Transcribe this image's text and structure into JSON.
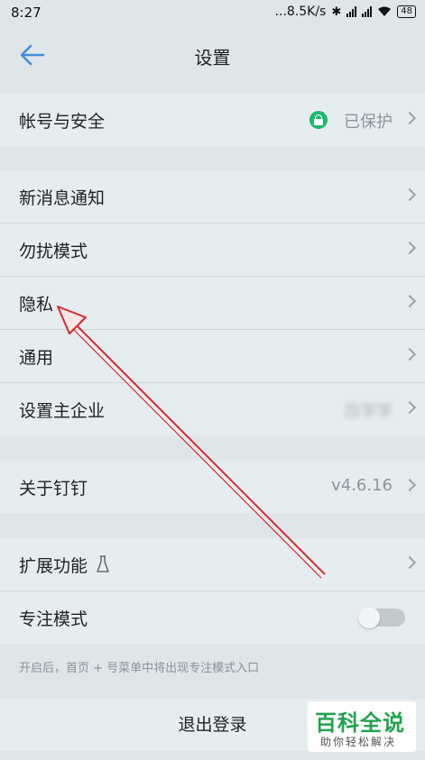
{
  "status_bar": {
    "time": "8:27",
    "network": "...8.5K/s",
    "battery": "48"
  },
  "header": {
    "title": "设置"
  },
  "account": {
    "label": "帐号与安全",
    "value": "已保护"
  },
  "notifications_group": [
    {
      "label": "新消息通知"
    },
    {
      "label": "勿扰模式"
    },
    {
      "label": "隐私"
    },
    {
      "label": "通用"
    },
    {
      "label": "设置主企业",
      "value": "吕学学"
    }
  ],
  "about": {
    "label": "关于钉钉",
    "value": "v4.6.16"
  },
  "extensions": {
    "label": "扩展功能"
  },
  "focus_mode": {
    "label": "专注模式",
    "enabled": false
  },
  "hint": "开启后，首页 + 号菜单中将出现专注模式入口",
  "logout": {
    "label": "退出登录"
  },
  "watermark": {
    "title": "百科全说",
    "subtitle": "助你轻松解决"
  },
  "colors": {
    "accent": "#3e8fd8",
    "secure_green": "#1db86a",
    "annotation_red": "#d42b2b"
  }
}
